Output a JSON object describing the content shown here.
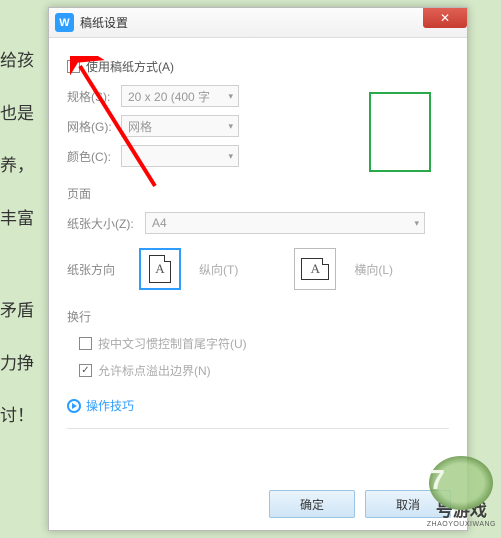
{
  "bg_lines": {
    "l1": "给孩",
    "l2": "也是",
    "l3": "养，",
    "l4": "丰富",
    "l5": "矛盾",
    "l6": "力挣",
    "l7": "讨！"
  },
  "titlebar": {
    "title": "稿纸设置",
    "app_glyph": "W",
    "close_glyph": "✕"
  },
  "main": {
    "use_writing_paper_label": "使用稿纸方式(A)",
    "spec_label": "规格(S):",
    "spec_value": "20 x 20 (400 字",
    "grid_label": "网格(G):",
    "grid_value": "网格",
    "color_label": "颜色(C):",
    "section_page": "页面",
    "paper_size_label": "纸张大小(Z):",
    "paper_size_value": "A4",
    "orientation_label": "纸张方向",
    "portrait_label": "纵向(T)",
    "landscape_label": "横向(L)",
    "page_glyph": "A",
    "section_wrap": "换行",
    "cjk_control_label": "按中文习惯控制首尾字符(U)",
    "overflow_label": "允许标点溢出边界(N)",
    "tips_label": "操作技巧"
  },
  "footer": {
    "ok": "确定",
    "cancel": "取消"
  },
  "combo_arrow": "▾",
  "watermark": {
    "num": "7",
    "text": "号游戏",
    "sub": "ZHAOYOUXIWANG"
  }
}
